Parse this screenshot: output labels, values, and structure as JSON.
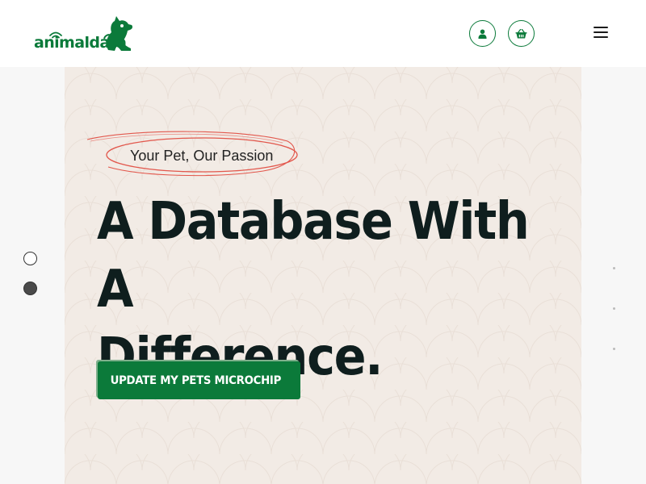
{
  "header": {
    "logo": {
      "brand_part1": "animal",
      "brand_part2": "data"
    },
    "icons": {
      "user": "user-icon",
      "basket": "basket-icon",
      "menu": "hamburger-menu-icon"
    }
  },
  "hero": {
    "tagline": "Your Pet, Our Passion",
    "headline_line1": "A Database With A",
    "headline_line2": "Difference.",
    "cta_label": "UPDATE MY PETS MICROCHIP"
  },
  "slider": {
    "count": 2,
    "active_index": 1
  },
  "colors": {
    "brand_green": "#0b7a3a",
    "hero_background": "#f2ebe5",
    "headline_text": "#0f1e1e",
    "tagline_scribble": "#e2574c"
  }
}
